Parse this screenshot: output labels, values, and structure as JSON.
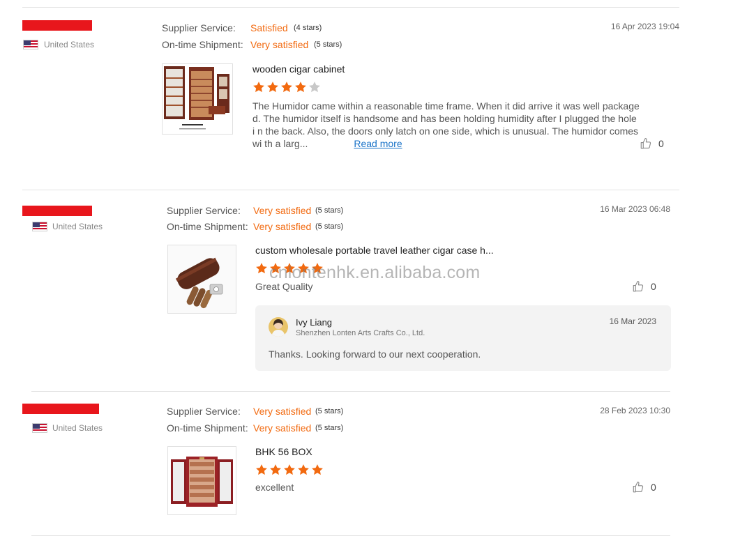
{
  "reviews": [
    {
      "country": "United States",
      "supplier_service_label": "Supplier Service:",
      "supplier_service_rating": "Satisfied",
      "supplier_service_stars": "(4 stars)",
      "shipment_label": "On-time Shipment:",
      "shipment_rating": "Very satisfied",
      "shipment_stars": "(5 stars)",
      "date": "16 Apr 2023 19:04",
      "product_title": "wooden cigar cabinet",
      "star_rating": 4,
      "text": "The Humidor came within a reasonable time frame.  When it did arrive it was well package d.  The humidor itself is handsome and has been holding humidity after I plugged the hole i n the back.  Also, the doors only latch on one side, which is unusual.  The humidor comes wi th a larg...",
      "read_more": "Read more",
      "likes": "0"
    },
    {
      "country": "United States",
      "supplier_service_label": "Supplier Service:",
      "supplier_service_rating": "Very satisfied",
      "supplier_service_stars": "(5 stars)",
      "shipment_label": "On-time Shipment:",
      "shipment_rating": "Very satisfied",
      "shipment_stars": "(5 stars)",
      "date": "16 Mar 2023 06:48",
      "product_title": "custom wholesale portable travel leather cigar case h...",
      "star_rating": 5,
      "text": "Great Quality",
      "likes": "0",
      "reply": {
        "name": "Ivy Liang",
        "company": "Shenzhen Lonten Arts Crafts Co., Ltd.",
        "date": "16 Mar 2023",
        "text": "Thanks. Looking forward to our next cooperation."
      }
    },
    {
      "country": "United States",
      "supplier_service_label": "Supplier Service:",
      "supplier_service_rating": "Very satisfied",
      "supplier_service_stars": "(5 stars)",
      "shipment_label": "On-time Shipment:",
      "shipment_rating": "Very satisfied",
      "shipment_stars": "(5 stars)",
      "date": "28 Feb 2023 10:30",
      "product_title": "BHK 56 BOX",
      "star_rating": 5,
      "text": "excellent",
      "likes": "0"
    }
  ],
  "watermark": "cnlontenhk.en.alibaba.com",
  "colors": {
    "accent": "#f26a10",
    "redaction": "#e8161c",
    "link": "#1a73c8",
    "reply_bg": "#f3f3f3"
  },
  "icons": [
    "us-flag-icon",
    "star-icon",
    "thumbs-up-icon"
  ]
}
